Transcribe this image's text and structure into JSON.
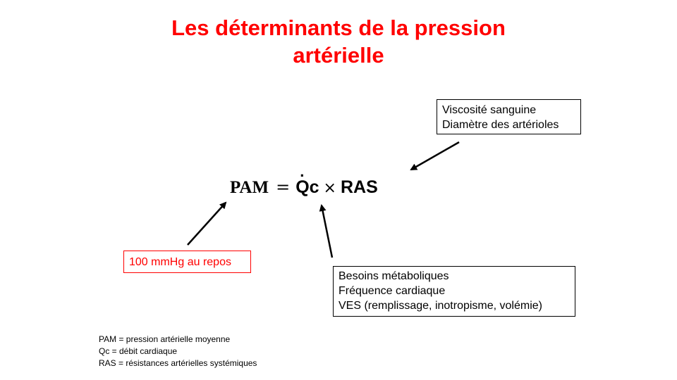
{
  "title": {
    "line1": "Les déterminants de la pression",
    "line2": "artérielle"
  },
  "formula": {
    "pam": "PAM",
    "equals": "=",
    "qc": "Qc",
    "qc_dot": "·",
    "times": "×",
    "ras": "RAS"
  },
  "boxes": {
    "ras_factors": [
      "Viscosité sanguine",
      "Diamètre des artérioles"
    ],
    "pam_value": "100 mmHg au repos",
    "qc_factors": [
      "Besoins métaboliques",
      "Fréquence cardiaque",
      "VES (remplissage, inotropisme, volémie)"
    ]
  },
  "legend": [
    "PAM = pression artérielle moyenne",
    "Qc = débit cardiaque",
    "RAS = résistances artérielles systémiques"
  ],
  "colors": {
    "title": "#ff0000",
    "highlight_box": "#ff0000",
    "text": "#000000",
    "background": "#ffffff"
  }
}
